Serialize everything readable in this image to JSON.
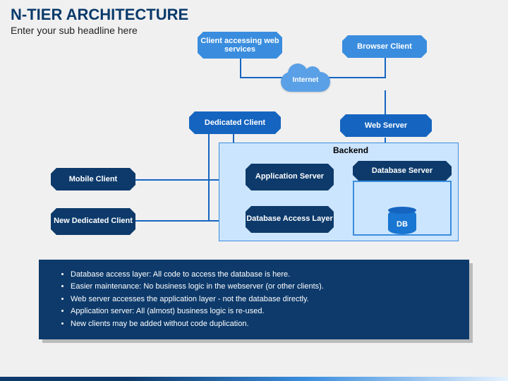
{
  "title": "N-TIER ARCHITECTURE",
  "subtitle": "Enter your sub headline here",
  "nodes": {
    "client_web": "Client accessing web services",
    "browser": "Browser Client",
    "internet": "Internet",
    "dedicated": "Dedicated Client",
    "webserver": "Web Server",
    "backend": "Backend",
    "mobile": "Mobile Client",
    "appserver": "Application Server",
    "dbserver": "Database Server",
    "newded": "New Dedicated Client",
    "dal": "Database Access Layer",
    "db": "DB"
  },
  "notes": [
    "Database access layer: All code to access the database is here.",
    "Easier maintenance:  No business logic in the webserver (or other clients).",
    "Web server accesses the application layer - not the database directly.",
    "Application server: All (almost) business logic is re-used.",
    "New clients may be added without code duplication."
  ]
}
